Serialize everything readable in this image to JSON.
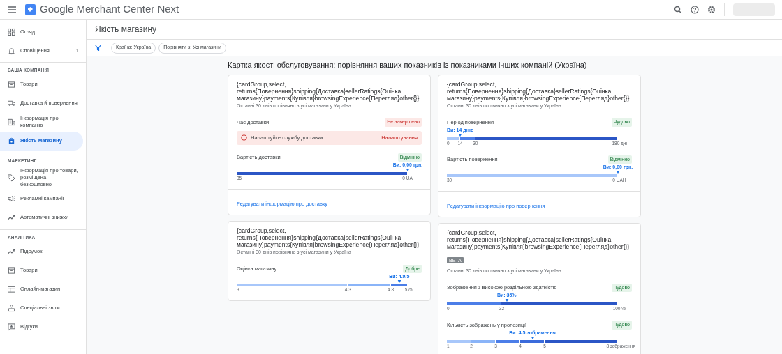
{
  "app_bar": {
    "title": "Google Merchant Center Next"
  },
  "sidebar": {
    "top_items": [
      {
        "label": "Огляд",
        "selected": false
      },
      {
        "label": "Сповіщення",
        "selected": false,
        "count": "1"
      }
    ],
    "sections": [
      {
        "heading": "ВАША КОМПАНІЯ",
        "items": [
          {
            "label": "Товари",
            "selected": false
          },
          {
            "label": "Доставка й повернення",
            "selected": false
          },
          {
            "label": "Інформація про компанію",
            "selected": false
          },
          {
            "label": "Якість магазину",
            "selected": true
          }
        ]
      },
      {
        "heading": "МАРКЕТИНГ",
        "items": [
          {
            "label": "Інформація про товари, розміщена безкоштовно",
            "selected": false
          },
          {
            "label": "Рекламні кампанії",
            "selected": false
          },
          {
            "label": "Автоматичні знижки",
            "selected": false
          }
        ]
      },
      {
        "heading": "АНАЛІТИКА",
        "items": [
          {
            "label": "Підсумок",
            "selected": false
          },
          {
            "label": "Товари",
            "selected": false
          },
          {
            "label": "Онлайн-магазин",
            "selected": false
          },
          {
            "label": "Спеціальні звіти",
            "selected": false
          },
          {
            "label": "Відгуки",
            "selected": false
          }
        ]
      }
    ]
  },
  "page": {
    "title": "Якість магазину",
    "filters": [
      "Країна: Україна",
      "Порівняти з: Усі магазини"
    ],
    "heading": "Картка якості обслуговування: порівняння ваших показників із показниками інших компаній (Україна)",
    "columns": [
      [
        {
          "title": "{cardGroup,select, returns{Повернення}shipping{Доставка}sellerRatings{Оцінка магазину}payments{Купівля}browsingExperience{Перегляд}other{}}",
          "subtitle": "Останні 30 днів порівняно з усі магазини у Україна",
          "metrics": [
            {
              "kind": "alert",
              "label": "Час доставки",
              "status": "Не завершено",
              "message": "Налаштуйте службу доставки",
              "action": "Налаштування"
            },
            {
              "kind": "bar",
              "label": "Вартість доставки",
              "status": "Відмінно",
              "marker": {
                "label": "Ви: 0,00 грн."
              },
              "segments": [
                {
                  "color": "#2b56c6"
                }
              ],
              "ticks": [
                "35",
                "0 UAH"
              ]
            }
          ],
          "link": "Редагувати інформацію про доставку"
        },
        {
          "title": "{cardGroup,select, returns{Повернення}shipping{Доставка}sellerRatings{Оцінка магазину}payments{Купівля}browsingExperience{Перегляд}other{}}",
          "subtitle": "Останні 30 днів порівняно з усі магазини у Україна",
          "metrics": [
            {
              "kind": "bar",
              "label": "Оцінка магазину",
              "status": "Добре",
              "marker": {
                "label": "Ви: 4.9/5"
              },
              "segments": [
                {
                  "color": "#a8c7fa"
                },
                {
                  "color": "#8ab4f8"
                },
                {
                  "color": "#4c7ee8"
                }
              ],
              "ticks": [
                "3",
                "4.3",
                "4.8",
                "5 /5"
              ]
            }
          ]
        }
      ],
      [
        {
          "title": "{cardGroup,select, returns{Повернення}shipping{Доставка}sellerRatings{Оцінка магазину}payments{Купівля}browsingExperience{Перегляд}other{}}",
          "subtitle": "Останні 30 днів порівняно з усі магазини у Україна",
          "metrics": [
            {
              "kind": "bar",
              "label": "Період повернення",
              "status": "Чудово",
              "marker": {
                "label": "Ви: 14 днів"
              },
              "segments": [
                {
                  "color": "#a8c7fa"
                },
                {
                  "color": "#4c7ee8"
                },
                {
                  "color": "#2b56c6"
                }
              ],
              "ticks": [
                "0",
                "14",
                "30",
                "180 дні"
              ]
            },
            {
              "kind": "bar",
              "label": "Вартість повернення",
              "status": "Відмінно",
              "marker": {
                "label": "Ви: 0,00 грн."
              },
              "segments": [
                {
                  "color": "#a8c7fa"
                }
              ],
              "ticks": [
                "30",
                "0 UAH"
              ]
            }
          ],
          "link": "Редагувати інформацію про повернення"
        },
        {
          "title": "{cardGroup,select, returns{Повернення}shipping{Доставка}sellerRatings{Оцінка магазину}payments{Купівля}browsingExperience{Перегляд}other{}}",
          "beta": "BETA",
          "subtitle": "Останні 30 днів порівняно з усі магазини у Україна",
          "metrics": [
            {
              "kind": "bar",
              "label": "Зображення з високою роздільною здатністю",
              "status": "Чудово",
              "marker": {
                "label": "Ви: 35%"
              },
              "segments": [
                {
                  "color": "#4c7ee8"
                },
                {
                  "color": "#2b56c6"
                }
              ],
              "ticks": [
                "0",
                "32",
                "100 %"
              ]
            },
            {
              "kind": "bar",
              "label": "Кількість зображень у пропозиції",
              "status": "Чудово",
              "marker": {
                "label": "Ви: 4.5 зображення"
              },
              "segments": [
                {
                  "color": "#a8c7fa"
                },
                {
                  "color": "#8ab4f8"
                },
                {
                  "color": "#4c7ee8"
                },
                {
                  "color": "#3b6bdb"
                },
                {
                  "color": "#2b56c6"
                }
              ],
              "ticks": [
                "1",
                "2",
                "3",
                "4",
                "5",
                "8 зображення"
              ]
            }
          ]
        }
      ]
    ]
  }
}
